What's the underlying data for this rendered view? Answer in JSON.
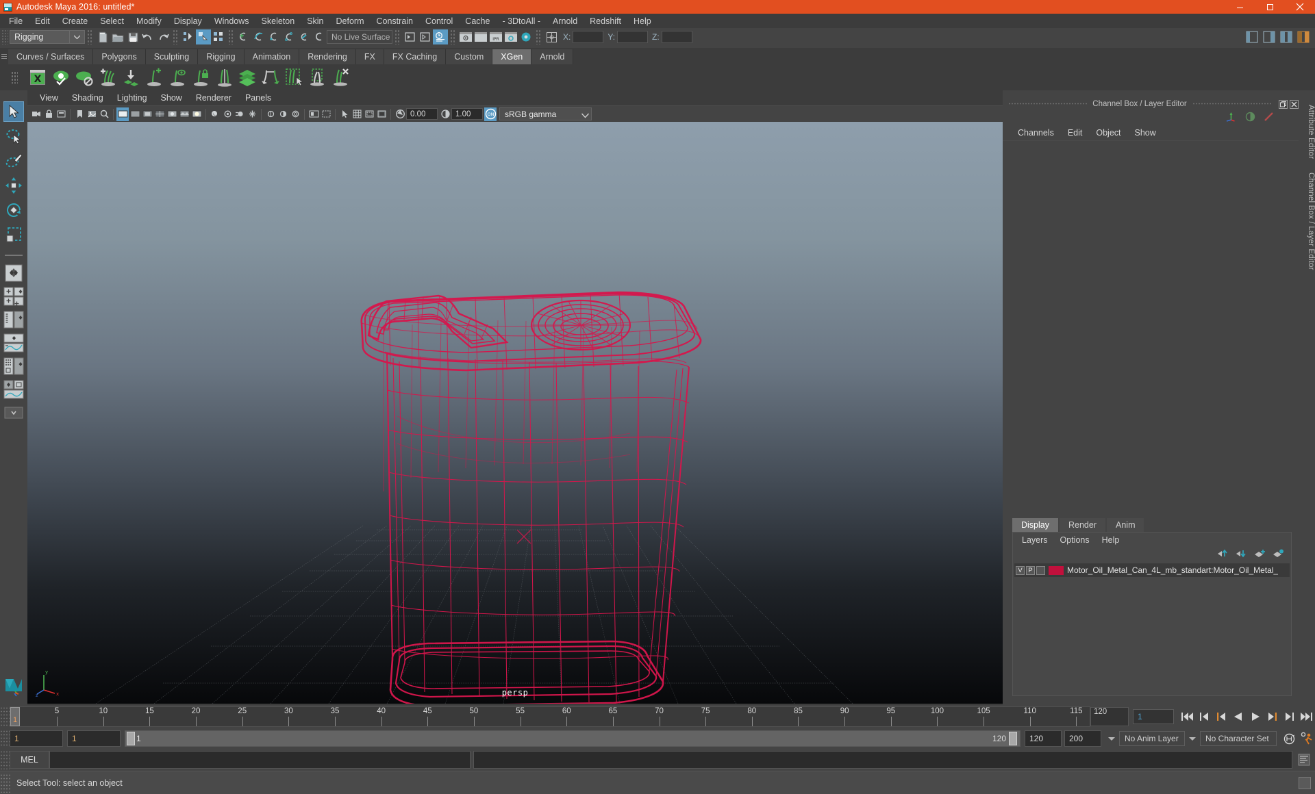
{
  "window": {
    "title": "Autodesk Maya 2016: untitled*",
    "app_icon": "maya-logo-icon",
    "controls": {
      "minimize": "minimize-icon",
      "maximize": "maximize-icon",
      "close": "close-icon"
    },
    "accent_color": "#e24f20"
  },
  "menubar": {
    "items": [
      "File",
      "Edit",
      "Create",
      "Select",
      "Modify",
      "Display",
      "Windows",
      "Skeleton",
      "Skin",
      "Deform",
      "Constrain",
      "Control",
      "Cache",
      "- 3DtoAll -",
      "Arnold",
      "Redshift",
      "Help"
    ]
  },
  "statusline": {
    "mode": "Rigging",
    "live_surface": "No Live Surface",
    "coords": {
      "x_label": "X:",
      "y_label": "Y:",
      "z_label": "Z:",
      "x_value": "",
      "y_value": "",
      "z_value": ""
    }
  },
  "shelf": {
    "tabs": [
      "Curves / Surfaces",
      "Polygons",
      "Sculpting",
      "Rigging",
      "Animation",
      "Rendering",
      "FX",
      "FX Caching",
      "Custom",
      "XGen",
      "Arnold"
    ],
    "active_tab": "XGen",
    "icons": [
      "xgen-window-icon",
      "xgen-preview-icon",
      "xgen-disable-preview-icon",
      "xgen-add-description-icon",
      "xgen-import-collection-icon",
      "xgen-add-guide-icon",
      "xgen-guide-visibility-icon",
      "xgen-lock-guide-icon",
      "xgen-mirror-guide-icon",
      "xgen-layer-icon",
      "xgen-convert-icon",
      "xgen-select-region-icon",
      "xgen-region-box-icon",
      "xgen-delete-guide-icon"
    ]
  },
  "toolbox": {
    "tools": [
      "select-tool",
      "lasso-select-tool",
      "paint-select-tool",
      "move-tool",
      "rotate-tool",
      "scale-tool"
    ],
    "active_tool": "select-tool",
    "layouts": [
      "single-pane-layout",
      "four-pane-layout",
      "outliner-persp-layout",
      "persp-graph-layout",
      "hypershade-persp-layout",
      "persp-graph-outliner-layout",
      "more-layouts"
    ]
  },
  "viewport": {
    "menus": [
      "View",
      "Shading",
      "Lighting",
      "Show",
      "Renderer",
      "Panels"
    ],
    "exposure": "0.00",
    "gamma": "1.00",
    "color_management_enabled": true,
    "color_profile": "sRGB gamma",
    "camera_label": "persp",
    "wireframe_color": "#d6164c"
  },
  "channel_box": {
    "panel_title": "Channel Box / Layer Editor",
    "menus": [
      "Channels",
      "Edit",
      "Object",
      "Show"
    ],
    "icons": [
      "channel-box-icon",
      "attribute-editor-icon",
      "tool-settings-icon"
    ]
  },
  "layer_editor": {
    "tabs": [
      "Display",
      "Render",
      "Anim"
    ],
    "active_tab": "Display",
    "menus": [
      "Layers",
      "Options",
      "Help"
    ],
    "arrow_buttons": [
      "move-layer-up-icon",
      "move-layer-down-icon",
      "new-layer-icon",
      "new-layer-from-selected-icon"
    ],
    "layers": [
      {
        "visibility": "V",
        "playback": "P",
        "state": "",
        "color": "#c2103c",
        "name": "Motor_Oil_Metal_Can_4L_mb_standart:Motor_Oil_Metal_"
      }
    ]
  },
  "side_tabs": [
    "Attribute Editor",
    "Channel Box / Layer Editor"
  ],
  "time_slider": {
    "current_frame": "1",
    "start": 1,
    "end": 120,
    "tick_labels": [
      "5",
      "10",
      "15",
      "20",
      "25",
      "30",
      "35",
      "40",
      "45",
      "50",
      "55",
      "60",
      "65",
      "70",
      "75",
      "80",
      "85",
      "90",
      "95",
      "100",
      "105",
      "110",
      "115",
      "120"
    ],
    "end_field": "120",
    "current_field": "1",
    "playback_buttons": [
      "go-to-start-icon",
      "step-back-keyframe-icon",
      "step-back-frame-icon",
      "play-backwards-icon",
      "play-forwards-icon",
      "step-forward-frame-icon",
      "step-forward-keyframe-icon",
      "go-to-end-icon"
    ]
  },
  "range_slider": {
    "anim_start": "1",
    "range_start": "1",
    "bar_min": "1",
    "bar_max": "120",
    "range_end": "120",
    "anim_end": "200",
    "anim_layer": "No Anim Layer",
    "character_set": "No Character Set",
    "auto_key_icon": "auto-keyframe-icon",
    "anim_prefs_icon": "animation-preferences-icon"
  },
  "command_line": {
    "language": "MEL",
    "input_value": "",
    "output_value": ""
  },
  "status_bar": {
    "message": "Select Tool: select an object"
  }
}
